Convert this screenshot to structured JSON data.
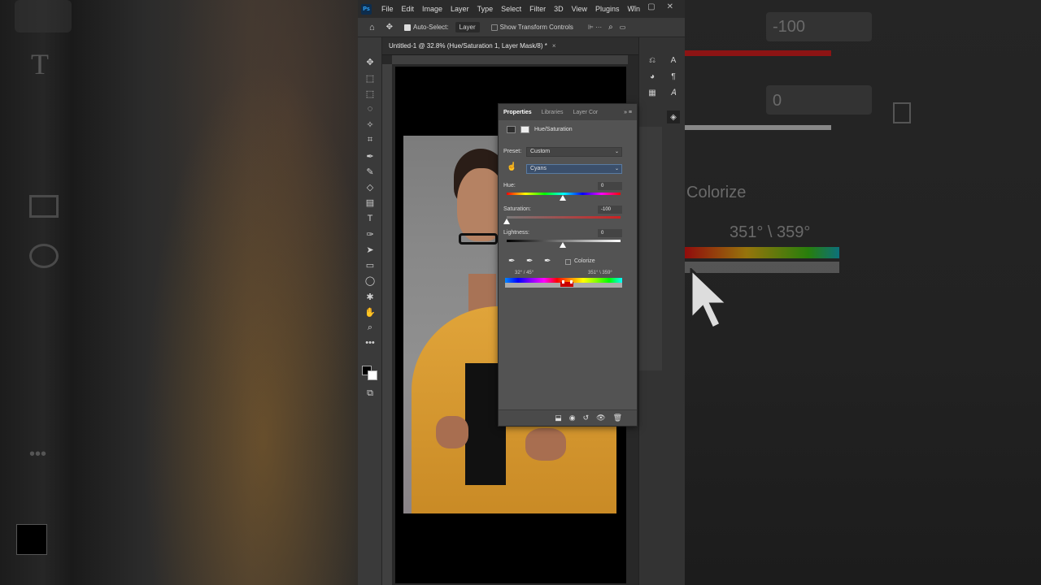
{
  "app": {
    "logo": "Ps"
  },
  "menu": [
    "File",
    "Edit",
    "Image",
    "Layer",
    "Type",
    "Select",
    "Filter",
    "3D",
    "View",
    "Plugins",
    "Win"
  ],
  "options_bar": {
    "auto_select_label": "Auto-Select:",
    "auto_select_value": "Layer",
    "transform_label": "Show Transform Controls"
  },
  "document_tab": {
    "title": "Untitled-1 @ 32.8% (Hue/Saturation 1, Layer Mask/8) *",
    "close": "×"
  },
  "properties": {
    "tabs": [
      "Properties",
      "Libraries",
      "Layer Cor"
    ],
    "adjustment_name": "Hue/Saturation",
    "preset_label": "Preset:",
    "preset_value": "Custom",
    "channel_value": "Cyans",
    "hue_label": "Hue:",
    "hue_value": "0",
    "saturation_label": "Saturation:",
    "saturation_value": "-100",
    "lightness_label": "Lightness:",
    "lightness_value": "0",
    "colorize_label": "Colorize",
    "range_left": "32° / 45°",
    "range_right": "351° \\ 359°"
  },
  "background_blur": {
    "value1": "-100",
    "value2": "0",
    "colorize": "Colorize",
    "range": "351° \\ 359°"
  },
  "colors": {
    "panel_bg": "#535353",
    "accent": "#31a8ff",
    "menu_bg": "#2b2b2b"
  }
}
